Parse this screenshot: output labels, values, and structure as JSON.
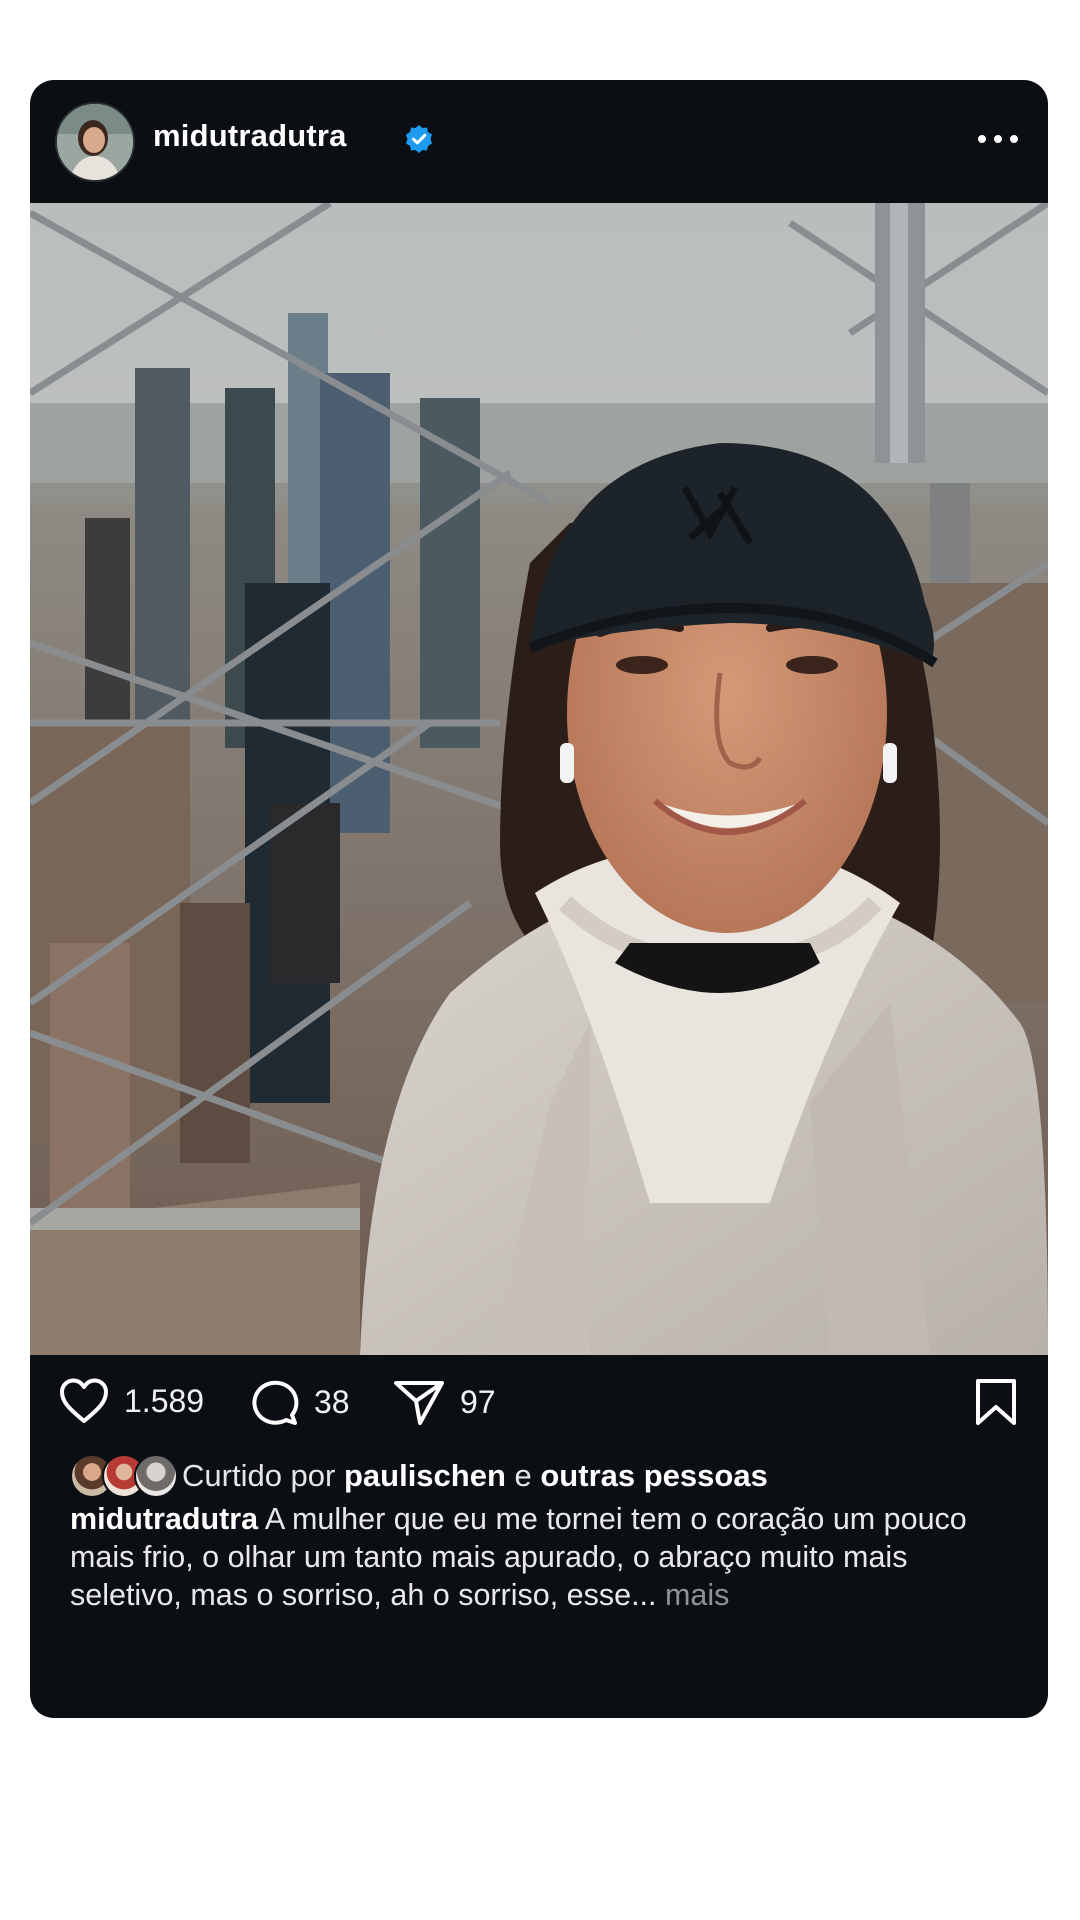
{
  "post": {
    "username": "midutradutra",
    "verified_icon": "verified-badge-icon",
    "more_icon": "more-options-icon",
    "accent_color": "#1d9bf0",
    "background_color": "#0b0f13",
    "photo_description_icon": "selfie-photo"
  },
  "actions": {
    "likes": "1.589",
    "comments": "38",
    "shares": "97"
  },
  "liked_by": {
    "prefix": "Curtido por ",
    "user": "paulischen",
    "connector": " e ",
    "others": "outras pessoas"
  },
  "caption": {
    "username": "midutradutra",
    "text": " A mulher que eu me tornei tem o coração um pouco mais frio, o olhar um tanto mais apurado, o abraço muito mais seletivo, mas o sorriso, ah o sorriso, esse... ",
    "more": "mais"
  }
}
